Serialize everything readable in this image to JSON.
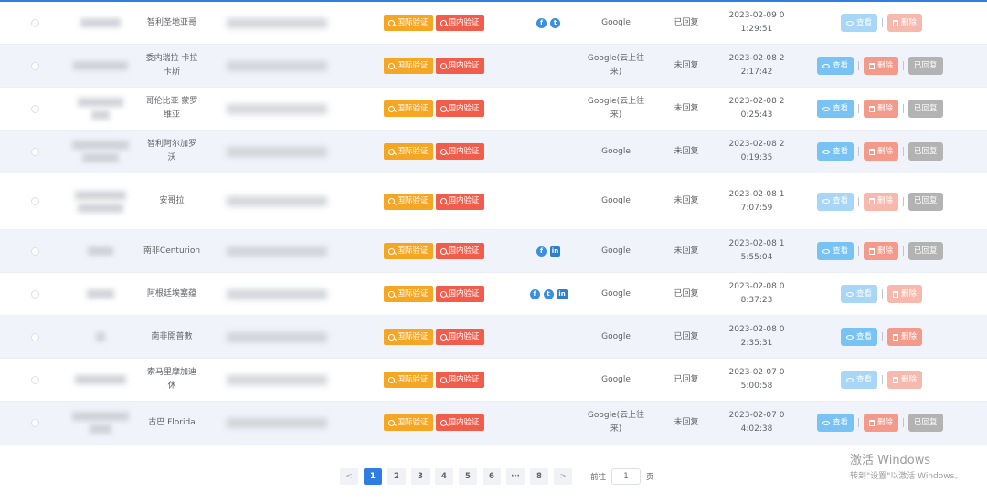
{
  "table": {
    "rows": [
      {
        "name": "智利圣地亚哥",
        "intl_btn": "国际验证",
        "dom_btn": "国内验证",
        "social": [
          "facebook-icon",
          "twitter-icon"
        ],
        "source": "Google",
        "status": "已回复",
        "date": "2023-02-09 0\n1:29:51",
        "actions": {
          "view": "查看",
          "delete": "删除",
          "replied": ""
        },
        "dim": true,
        "height": 47
      },
      {
        "name": "委内瑞拉 卡拉\n卡斯",
        "intl_btn": "国际验证",
        "dom_btn": "国内验证",
        "social": [],
        "source": "Google(云上往\n来)",
        "status": "未回复",
        "date": "2023-02-08 2\n2:17:42",
        "actions": {
          "view": "查看",
          "delete": "删除",
          "replied": "已回复"
        },
        "dim": false,
        "height": 47
      },
      {
        "name": "哥伦比亚 蒙罗\n维亚",
        "intl_btn": "国际验证",
        "dom_btn": "国内验证",
        "social": [],
        "source": "Google(云上往\n来)",
        "status": "未回复",
        "date": "2023-02-08 2\n0:25:43",
        "actions": {
          "view": "查看",
          "delete": "删除",
          "replied": "已回复"
        },
        "dim": false,
        "height": 47
      },
      {
        "name": "智利阿尔加罗\n沃",
        "intl_btn": "国际验证",
        "dom_btn": "国内验证",
        "social": [],
        "source": "Google",
        "status": "未回复",
        "date": "2023-02-08 2\n0:19:35",
        "actions": {
          "view": "查看",
          "delete": "删除",
          "replied": "已回复"
        },
        "dim": false,
        "height": 47
      },
      {
        "name": "安哥拉",
        "intl_btn": "国际验证",
        "dom_btn": "国内验证",
        "social": [],
        "source": "Google",
        "status": "未回复",
        "date": "2023-02-08 1\n7:07:59",
        "actions": {
          "view": "查看",
          "delete": "删除",
          "replied": "已回复"
        },
        "dim": true,
        "height": 62
      },
      {
        "name": "南非Centurion",
        "intl_btn": "国际验证",
        "dom_btn": "国内验证",
        "social": [
          "facebook-icon",
          "linkedin-icon"
        ],
        "source": "Google",
        "status": "未回复",
        "date": "2023-02-08 1\n5:55:04",
        "actions": {
          "view": "查看",
          "delete": "删除",
          "replied": "已回复"
        },
        "dim": false,
        "height": 47
      },
      {
        "name": "阿根廷埃塞蕴",
        "intl_btn": "国际验证",
        "dom_btn": "国内验证",
        "social": [
          "facebook-icon",
          "twitter-icon",
          "linkedin-icon"
        ],
        "source": "Google",
        "status": "已回复",
        "date": "2023-02-08 0\n8:37:23",
        "actions": {
          "view": "查看",
          "delete": "删除",
          "replied": ""
        },
        "dim": true,
        "height": 47
      },
      {
        "name": "南非開普數",
        "intl_btn": "国际验证",
        "dom_btn": "国内验证",
        "social": [],
        "source": "Google",
        "status": "已回复",
        "date": "2023-02-08 0\n2:35:31",
        "actions": {
          "view": "查看",
          "delete": "删除",
          "replied": ""
        },
        "dim": false,
        "height": 47
      },
      {
        "name": "索马里摩加迪\n休",
        "intl_btn": "国际验证",
        "dom_btn": "国内验证",
        "social": [],
        "source": "Google",
        "status": "已回复",
        "date": "2023-02-07 0\n5:00:58",
        "actions": {
          "view": "查看",
          "delete": "删除",
          "replied": ""
        },
        "dim": true,
        "height": 47
      },
      {
        "name": "古巴 Florida",
        "intl_btn": "国际验证",
        "dom_btn": "国内验证",
        "social": [],
        "source": "Google(云上往\n来)",
        "status": "未回复",
        "date": "2023-02-07 0\n4:02:38",
        "actions": {
          "view": "查看",
          "delete": "删除",
          "replied": "已回复"
        },
        "dim": false,
        "height": 47
      }
    ]
  },
  "pagination": {
    "prev": "<",
    "pages": [
      "1",
      "2",
      "3",
      "4",
      "5",
      "6",
      "···",
      "8"
    ],
    "active": "1",
    "next": ">",
    "goto_label": "前往",
    "goto_value": "1",
    "goto_unit": "页"
  },
  "watermark": {
    "line1": "激活 Windows",
    "line2": "转到\"设置\"以激活 Windows。"
  },
  "colors": {
    "accent": "#2f7de1",
    "intl": "#f5a623",
    "domestic": "#f25c4b",
    "view": "#78c3f3",
    "delete": "#f39a8b",
    "replied": "#b3b3b3"
  }
}
